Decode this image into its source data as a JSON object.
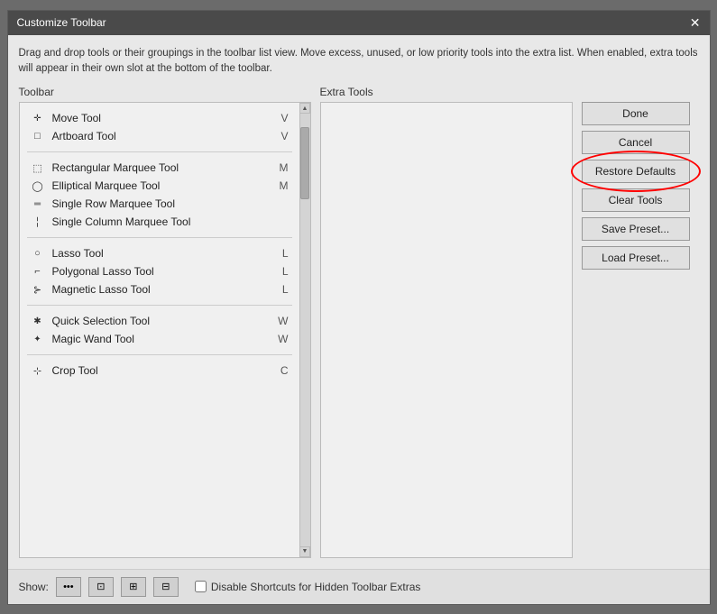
{
  "dialog": {
    "title": "Customize Toolbar",
    "close_label": "✕",
    "description": "Drag and drop tools or their groupings in the toolbar list view. Move excess, unused, or low priority tools into the extra list. When enabled, extra tools will appear in their own slot at the bottom of the toolbar."
  },
  "toolbar_panel": {
    "label": "Toolbar"
  },
  "extra_tools_panel": {
    "label": "Extra Tools"
  },
  "tool_groups": [
    {
      "tools": [
        {
          "name": "Move Tool",
          "shortcut": "V",
          "icon": "move"
        },
        {
          "name": "Artboard Tool",
          "shortcut": "V",
          "icon": "artboard"
        }
      ]
    },
    {
      "tools": [
        {
          "name": "Rectangular Marquee Tool",
          "shortcut": "M",
          "icon": "rect-marquee"
        },
        {
          "name": "Elliptical Marquee Tool",
          "shortcut": "M",
          "icon": "ellip-marquee"
        },
        {
          "name": "Single Row Marquee Tool",
          "shortcut": "",
          "icon": "row-marquee"
        },
        {
          "name": "Single Column Marquee Tool",
          "shortcut": "",
          "icon": "col-marquee"
        }
      ]
    },
    {
      "tools": [
        {
          "name": "Lasso Tool",
          "shortcut": "L",
          "icon": "lasso"
        },
        {
          "name": "Polygonal Lasso Tool",
          "shortcut": "L",
          "icon": "poly-lasso"
        },
        {
          "name": "Magnetic Lasso Tool",
          "shortcut": "L",
          "icon": "mag-lasso"
        }
      ]
    },
    {
      "tools": [
        {
          "name": "Quick Selection Tool",
          "shortcut": "W",
          "icon": "quick-sel"
        },
        {
          "name": "Magic Wand Tool",
          "shortcut": "W",
          "icon": "magic-wand"
        }
      ]
    },
    {
      "tools": [
        {
          "name": "Crop Tool",
          "shortcut": "C",
          "icon": "crop"
        }
      ]
    }
  ],
  "buttons": {
    "done": "Done",
    "cancel": "Cancel",
    "restore_defaults": "Restore Defaults",
    "clear_tools": "Clear Tools",
    "save_preset": "Save Preset...",
    "load_preset": "Load Preset..."
  },
  "bottom_bar": {
    "show_label": "Show:",
    "btn1": "•••",
    "btn2": "⊡",
    "btn3": "⊞",
    "btn4": "⊟",
    "checkbox_label": "Disable Shortcuts for Hidden Toolbar Extras",
    "checkbox_checked": false
  }
}
